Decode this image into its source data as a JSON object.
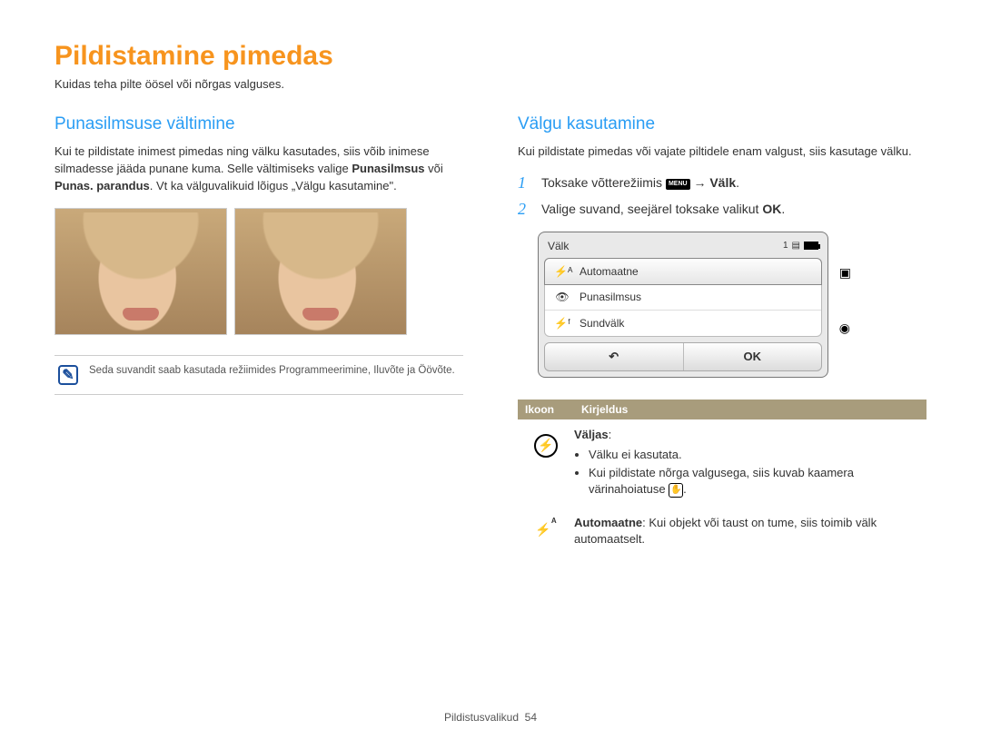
{
  "title": "Pildistamine pimedas",
  "subtitle": "Kuidas teha pilte öösel või nõrgas valguses.",
  "left": {
    "heading": "Punasilmsuse vältimine",
    "para_pre": "Kui te pildistate inimest pimedas ning välku kasutades, siis võib inimese silmadesse jääda punane kuma. Selle vältimiseks valige ",
    "bold1": "Punasilmsus",
    "mid": " või ",
    "bold2": "Punas. parandus",
    "para_post": ". Vt ka välguvalikuid lõigus „Välgu kasutamine\".",
    "note": "Seda suvandit saab kasutada režiimides Programmeerimine, Iluvõte ja Öövõte."
  },
  "right": {
    "heading": "Välgu kasutamine",
    "intro": "Kui pildistate pimedas või vajate piltidele enam valgust, siis kasutage välku.",
    "step1_pre": "Toksake võtterežiimis ",
    "step1_icon": "MENU",
    "step1_mid": " → ",
    "step1_bold": "Välk",
    "step1_post": ".",
    "step2_pre": "Valige suvand, seejärel toksake valikut ",
    "step2_icon": "OK",
    "step2_post": "."
  },
  "menu": {
    "title": "Välk",
    "count": "1",
    "items": [
      {
        "icon": "⚡ᴬ",
        "label": "Automaatne"
      },
      {
        "icon": "👁",
        "label": "Punasilmsus"
      },
      {
        "icon": "⚡ᶠ",
        "label": "Sundvälk"
      }
    ],
    "back": "↶",
    "ok": "OK"
  },
  "table": {
    "h1": "Ikoon",
    "h2": "Kirjeldus",
    "row1": {
      "title": "Väljas",
      "b1": "Välku ei kasutata.",
      "b2_pre": "Kui pildistate nõrga valgusega, siis kuvab kaamera värinahoiatuse ",
      "b2_post": "."
    },
    "row2": {
      "bold": "Automaatne",
      "text": ": Kui objekt või taust on tume, siis toimib välk automaatselt."
    }
  },
  "footer_label": "Pildistusvalikud",
  "footer_page": "54"
}
